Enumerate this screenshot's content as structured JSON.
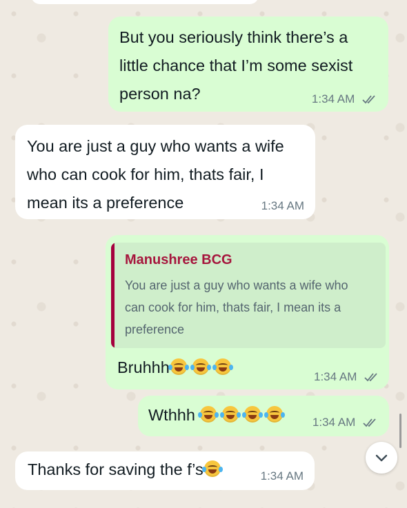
{
  "messages": [
    {
      "id": "m0",
      "direction": "outgoing",
      "text": "",
      "time": ""
    },
    {
      "id": "m1",
      "direction": "outgoing",
      "lines": [
        "But you seriously think there’s a",
        "little chance that I’m some sexist",
        "person na?"
      ],
      "time": "1:34 AM",
      "status": "read"
    },
    {
      "id": "m2",
      "direction": "incoming",
      "lines": [
        "You are just a guy who wants a wife",
        "who can cook for him, thats fair, I",
        "mean its a preference"
      ],
      "time": "1:34 AM"
    },
    {
      "id": "m3",
      "direction": "outgoing",
      "quote": {
        "author": "Manushree BCG",
        "lines": [
          "You are just a guy who wants a wife who",
          "can cook for him, thats fair, I mean its a",
          "preference"
        ]
      },
      "text": "Bruhhh",
      "emoji_count": 3,
      "time": "1:34 AM",
      "status": "read"
    },
    {
      "id": "m4",
      "direction": "outgoing",
      "text": "Wthhh",
      "emoji_count": 4,
      "time": "1:34 AM",
      "status": "read"
    },
    {
      "id": "m5",
      "direction": "incoming",
      "text": "Thanks for saving the f’s",
      "emoji_count": 1,
      "time": "1:34 AM"
    }
  ],
  "emoji": "face-with-tears-of-joy",
  "colors": {
    "outgoing_bubble": "#d9fdd3",
    "incoming_bubble": "#ffffff",
    "quote_bar": "#a5003e",
    "quote_author": "#a6163d",
    "read_ticks": "#667781"
  }
}
